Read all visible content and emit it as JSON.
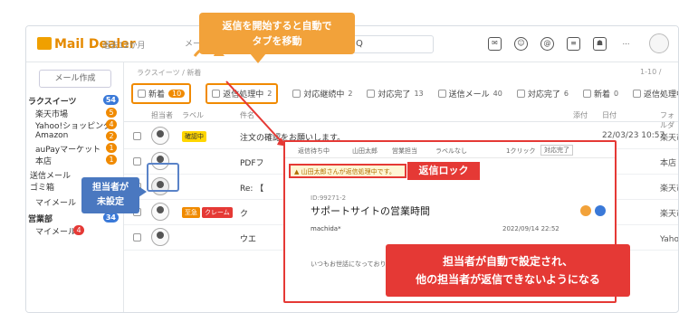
{
  "app": {
    "logo": "Mail Dealer",
    "period": "過去12か月",
    "mailbox": "メールボックス",
    "search_placeholder": "Q"
  },
  "sidebar": {
    "compose": "メール作成",
    "groups": [
      {
        "label": "ラクスイーツ",
        "badge": "54"
      },
      {
        "label": "営業部",
        "badge": "34"
      }
    ],
    "items": [
      {
        "label": "楽天市場",
        "badge": "5"
      },
      {
        "label": "Yahoo!ショッピング",
        "badge": "4"
      },
      {
        "label": "Amazon",
        "badge": "2"
      },
      {
        "label": "auPayマーケット",
        "badge": "1"
      },
      {
        "label": "本店",
        "badge": "1"
      },
      {
        "label": "送信メール"
      },
      {
        "label": "ゴミ箱"
      },
      {
        "label": "マイメール"
      },
      {
        "label": "マイメール",
        "badge": "4"
      }
    ]
  },
  "main": {
    "breadcrumb": "ラクスイーツ / 新着",
    "pager": "1-10 /",
    "tabs": [
      {
        "label": "新着",
        "num": "10"
      },
      {
        "label": "返信処理中",
        "num": "2"
      },
      {
        "label": "対応継続中",
        "num": "2"
      },
      {
        "label": "対応完了",
        "num": "13"
      },
      {
        "label": "送信メール",
        "num": "40"
      },
      {
        "label": "対応完了",
        "num": "6"
      },
      {
        "label": "新着",
        "num": "0"
      },
      {
        "label": "返信処理中",
        "num": "0"
      },
      {
        "label": "対応"
      }
    ],
    "columns": {
      "assignee": "担当者",
      "label": "ラベル",
      "subject": "件名",
      "attach": "添付",
      "date": "日付",
      "folder": "フォルダ"
    },
    "rows": [
      {
        "label": "確認中",
        "label_color": "#ffd600",
        "subject": "注文の確認をお願いします。",
        "date": "22/03/23 10:57",
        "folder": "楽天市場"
      },
      {
        "label": "",
        "subject": "PDFフ",
        "date": "",
        "folder": "本店"
      },
      {
        "label": "",
        "subject": "Re: 【",
        "date": "",
        "folder": "楽天市場"
      },
      {
        "label": "至急",
        "label2": "クレーム",
        "label_color": "#f08a00",
        "subject": "ク",
        "date": "",
        "folder": "楽天市場"
      },
      {
        "label": "",
        "subject": "ウエ",
        "date": "",
        "folder": "Yahoo!シ"
      }
    ]
  },
  "detail": {
    "toolbar": [
      "返信待ち中",
      "山田太郎",
      "営業担当",
      "ラベルなし",
      "1クリック",
      "対応完了"
    ],
    "lock_message": "山田太郎さんが返信処理中です。",
    "message_id": "ID:99271-2",
    "subject": "サポートサイトの営業時間",
    "sender": "machida*",
    "date": "2022/09/14 22:52",
    "body": "いつもお世話になっております。"
  },
  "annotations": {
    "callout_top": "返信を開始すると自動で\nタブを移動",
    "lock_label": "返信ロック",
    "assign_tip": "担当者が\n未設定",
    "bottom": "担当者が自動で設定され、\n他の担当者が返信できないようになる"
  }
}
